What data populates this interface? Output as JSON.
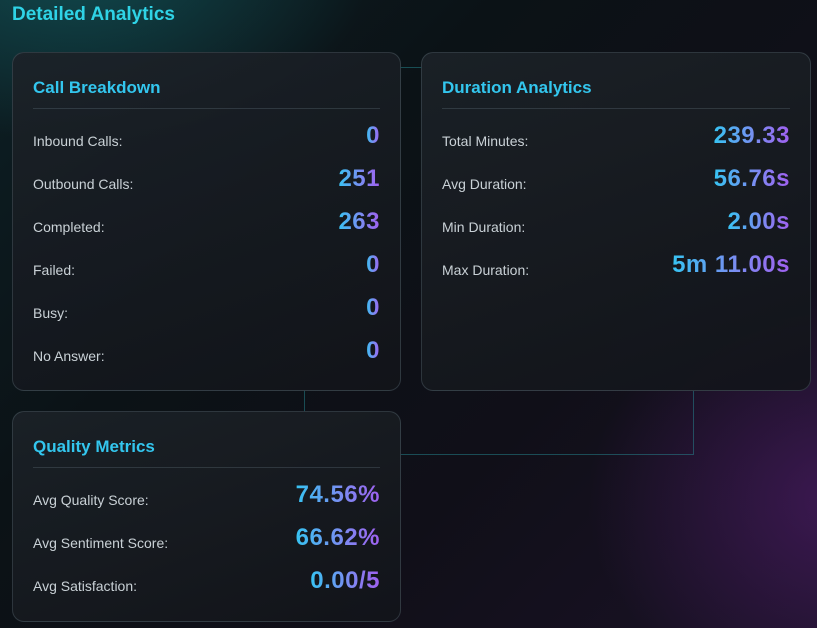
{
  "page": {
    "title": "Detailed Analytics"
  },
  "call_breakdown": {
    "title": "Call Breakdown",
    "rows": [
      {
        "label": "Inbound Calls:",
        "value": "0"
      },
      {
        "label": "Outbound Calls:",
        "value": "251"
      },
      {
        "label": "Completed:",
        "value": "263"
      },
      {
        "label": "Failed:",
        "value": "0"
      },
      {
        "label": "Busy:",
        "value": "0"
      },
      {
        "label": "No Answer:",
        "value": "0"
      }
    ]
  },
  "duration_analytics": {
    "title": "Duration Analytics",
    "rows": [
      {
        "label": "Total Minutes:",
        "value": "239.33"
      },
      {
        "label": "Avg Duration:",
        "value": "56.76s"
      },
      {
        "label": "Min Duration:",
        "value": "2.00s"
      },
      {
        "label": "Max Duration:",
        "value": "5m 11.00s"
      }
    ]
  },
  "quality_metrics": {
    "title": "Quality Metrics",
    "rows": [
      {
        "label": "Avg Quality Score:",
        "value": "74.56%"
      },
      {
        "label": "Avg Sentiment Score:",
        "value": "66.62%"
      },
      {
        "label": "Avg Satisfaction:",
        "value": "0.00/5"
      }
    ]
  },
  "colors": {
    "title": "#2fd3e6",
    "card_heading": "#33c6ee",
    "value_gradient_start": "#37c3f2",
    "value_gradient_end": "#a060f0",
    "label": "#c9d1d6"
  }
}
